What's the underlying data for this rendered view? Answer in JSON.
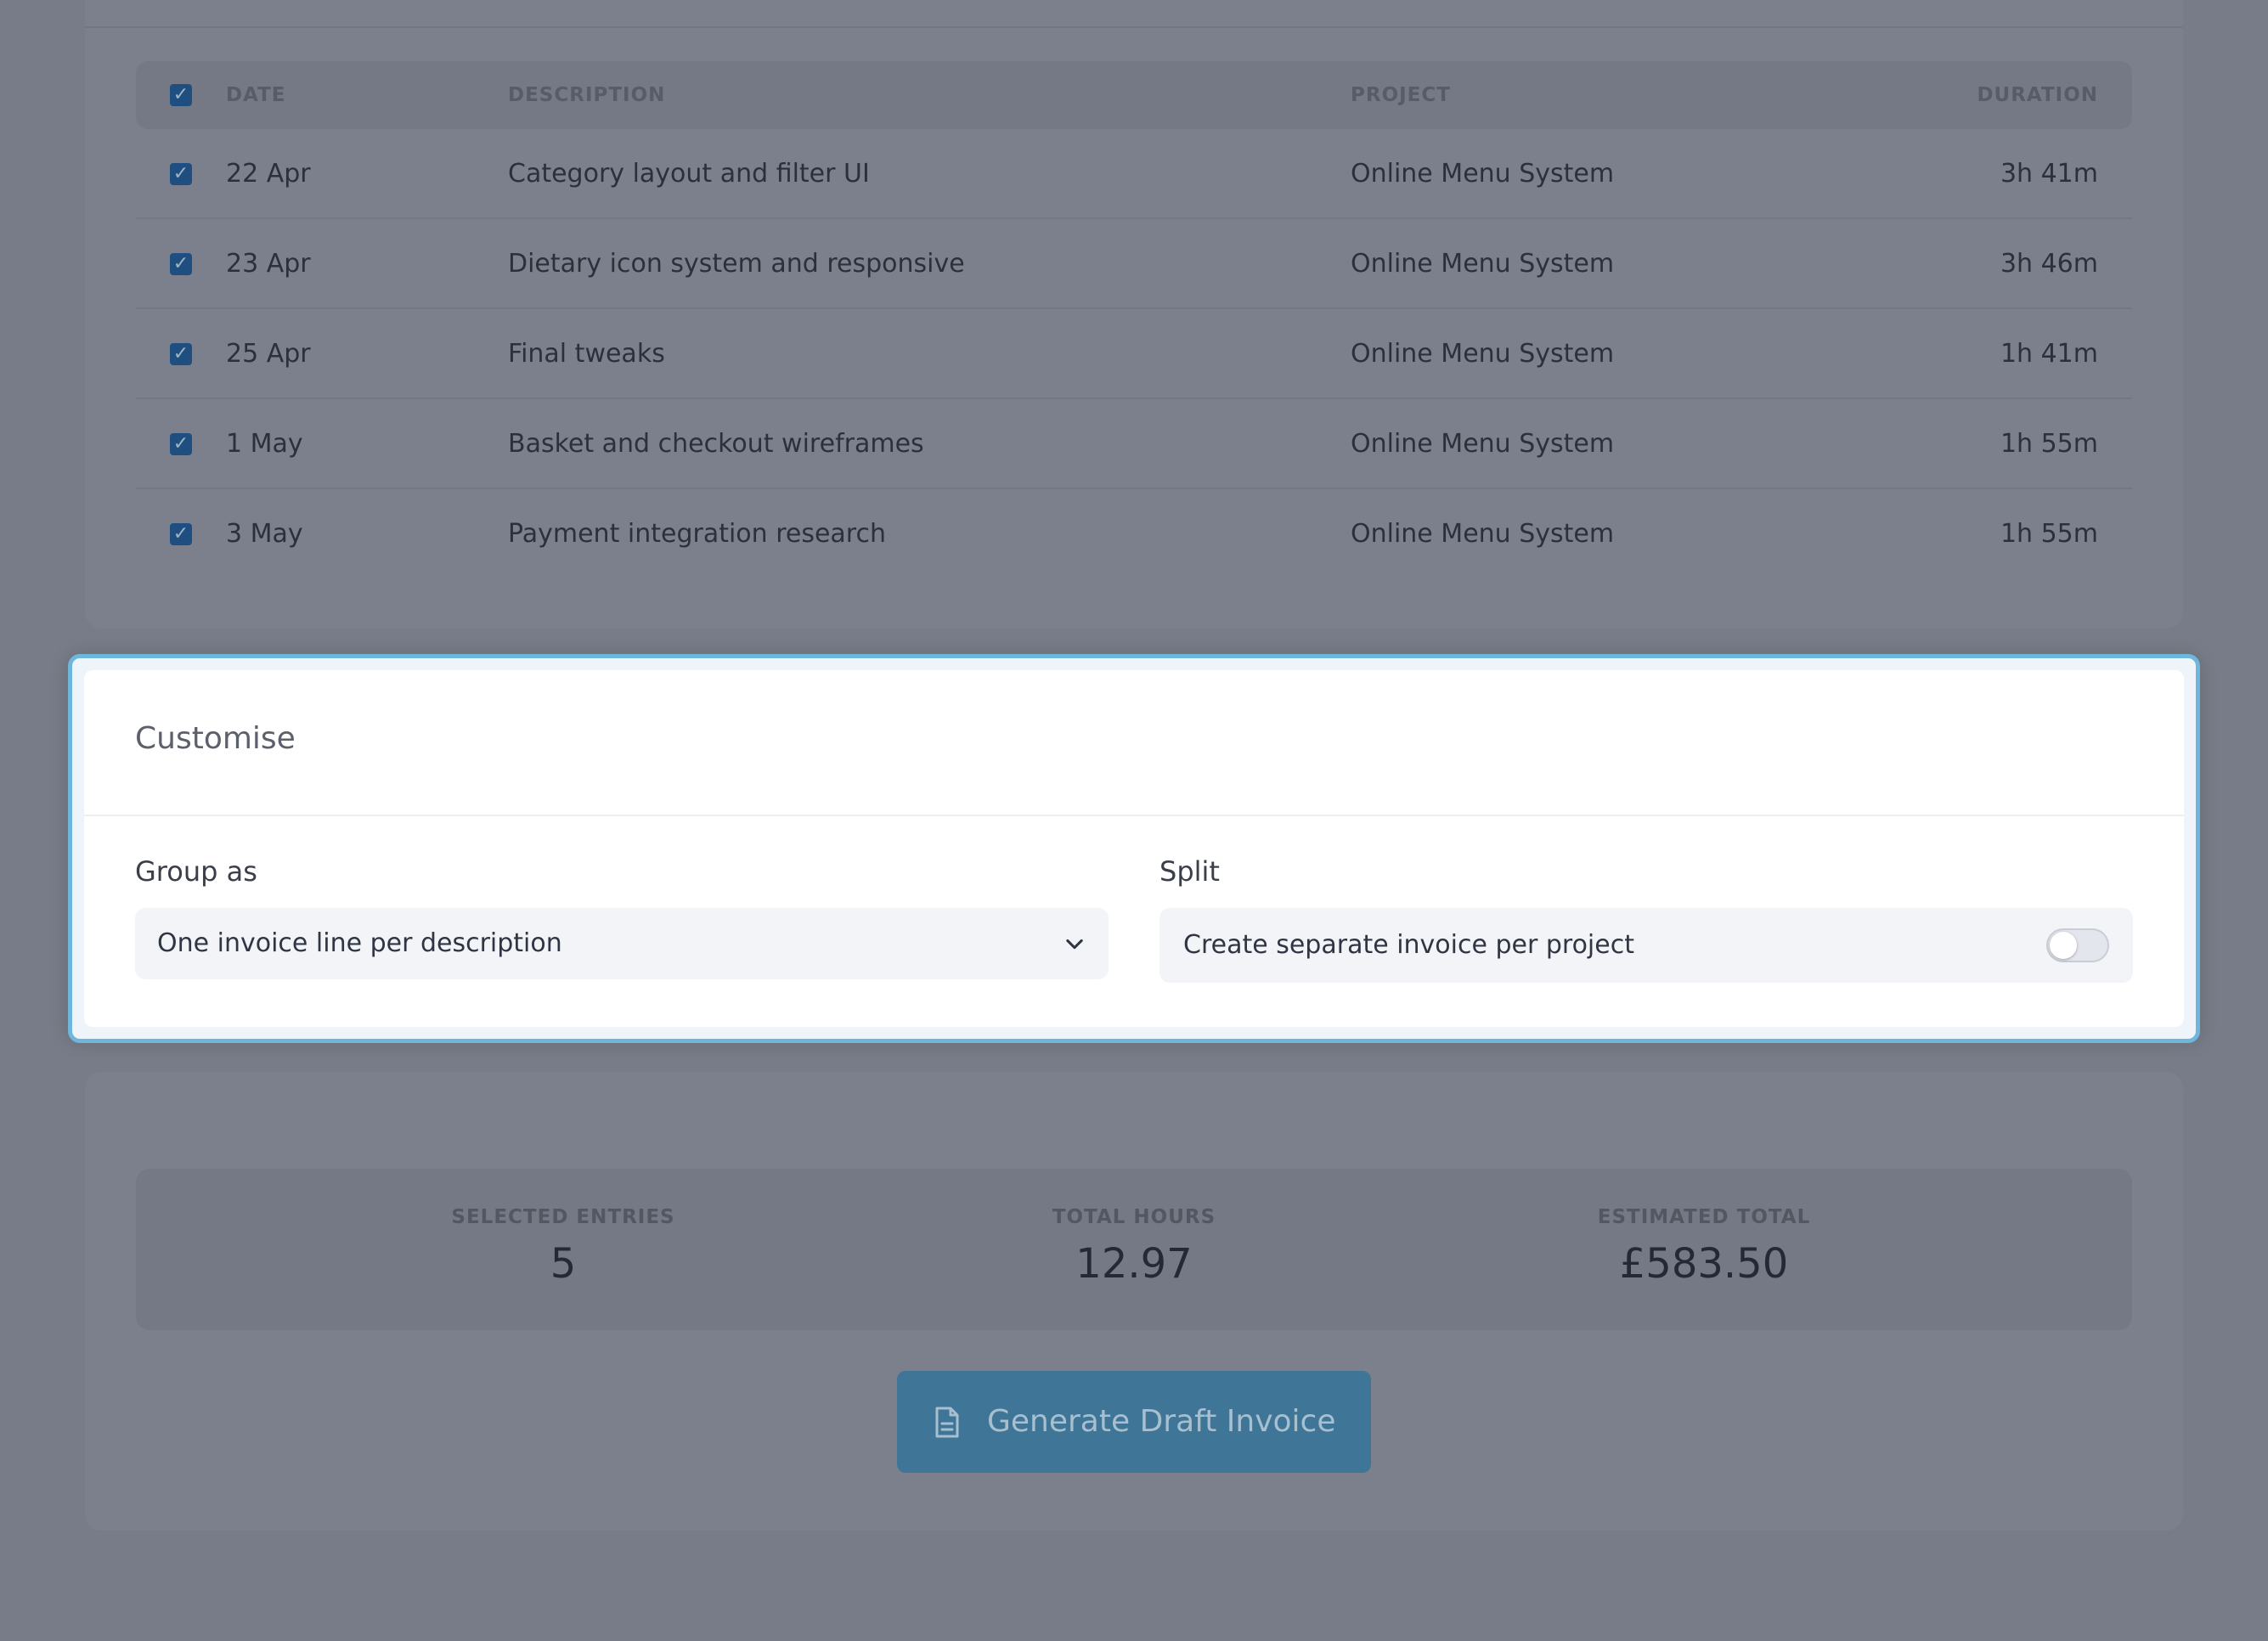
{
  "table": {
    "headers": {
      "date": "DATE",
      "description": "DESCRIPTION",
      "project": "PROJECT",
      "duration": "DURATION"
    },
    "rows": [
      {
        "date": "22 Apr",
        "description": "Category layout and filter UI",
        "project": "Online Menu System",
        "duration": "3h 41m",
        "checked": true
      },
      {
        "date": "23 Apr",
        "description": "Dietary icon system and responsive",
        "project": "Online Menu System",
        "duration": "3h 46m",
        "checked": true
      },
      {
        "date": "25 Apr",
        "description": "Final tweaks",
        "project": "Online Menu System",
        "duration": "1h 41m",
        "checked": true
      },
      {
        "date": "1 May",
        "description": "Basket and checkout wireframes",
        "project": "Online Menu System",
        "duration": "1h 55m",
        "checked": true
      },
      {
        "date": "3 May",
        "description": "Payment integration research",
        "project": "Online Menu System",
        "duration": "1h 55m",
        "checked": true
      }
    ]
  },
  "customise": {
    "title": "Customise",
    "group_label": "Group as",
    "group_value": "One invoice line per description",
    "split_label": "Split",
    "split_option": "Create separate invoice per project",
    "split_enabled": false
  },
  "summary": {
    "selected_entries_label": "SELECTED ENTRIES",
    "selected_entries_value": "5",
    "total_hours_label": "TOTAL HOURS",
    "total_hours_value": "12.97",
    "estimated_total_label": "ESTIMATED TOTAL",
    "estimated_total_value": "£583.50"
  },
  "actions": {
    "generate_label": "Generate Draft Invoice"
  },
  "icons": {
    "checkbox": "check-icon",
    "chevron": "chevron-down-icon",
    "document": "document-icon"
  },
  "colors": {
    "accent": "#3f7597",
    "focus_border": "#6fb6dc",
    "checkbox": "#1e4f80"
  }
}
